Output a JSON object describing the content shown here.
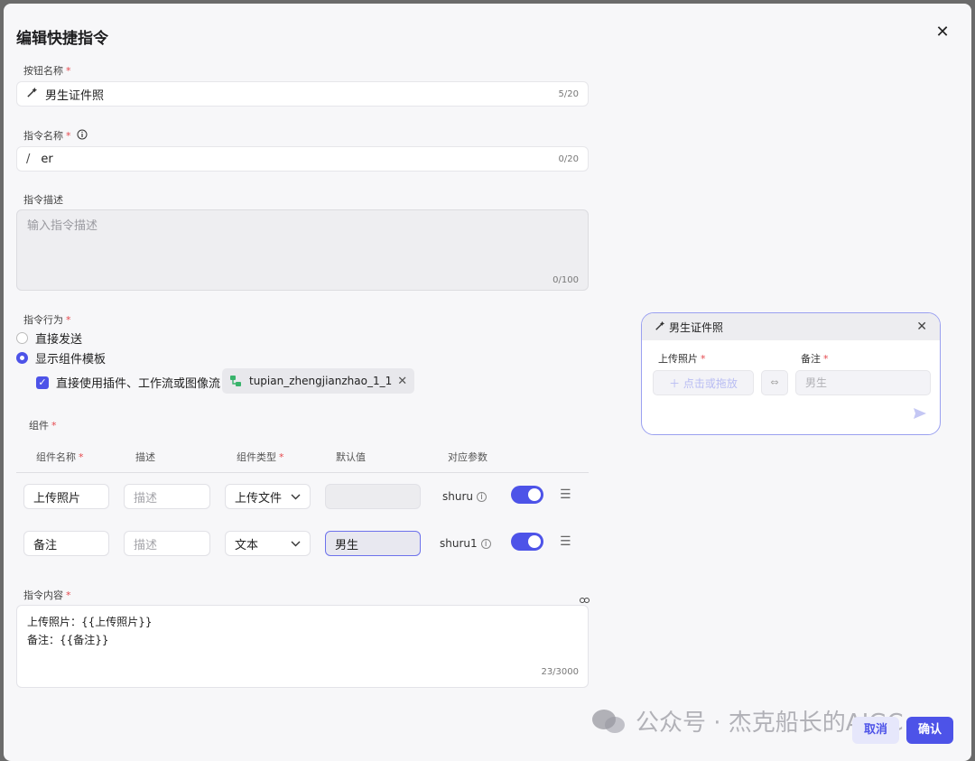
{
  "modal": {
    "title": "编辑快捷指令",
    "close_glyph": "✕"
  },
  "button_name": {
    "label": "按钮名称",
    "required_mark": "*",
    "value": "男生证件照",
    "counter": "5/20",
    "icon": "wand-icon"
  },
  "command_name": {
    "label": "指令名称",
    "required_mark": "*",
    "prefix": "/",
    "value": "er",
    "counter": "0/20"
  },
  "command_desc": {
    "label": "指令描述",
    "placeholder": "输入指令描述",
    "counter": "0/100"
  },
  "command_action": {
    "label": "指令行为",
    "required_mark": "*",
    "options": [
      {
        "label": "直接发送",
        "selected": false
      },
      {
        "label": "显示组件模板",
        "selected": true
      }
    ],
    "checkbox_label": "直接使用插件、工作流或图像流",
    "checkbox_checked": true,
    "workflow_chip": "tupian_zhengjianzhao_1_1",
    "chip_close": "✕"
  },
  "components": {
    "label": "组件",
    "required_mark": "*",
    "columns": {
      "name": "组件名称",
      "desc": "描述",
      "type": "组件类型",
      "default": "默认值",
      "param": "对应参数"
    },
    "rows": [
      {
        "name": "上传照片",
        "desc_placeholder": "描述",
        "type": "上传文件",
        "default": "",
        "param": "shuru",
        "enabled": true
      },
      {
        "name": "备注",
        "desc_placeholder": "描述",
        "type": "文本",
        "default": "男生",
        "param": "shuru1",
        "enabled": true
      }
    ]
  },
  "command_content": {
    "label": "指令内容",
    "required_mark": "*",
    "line1": "上传照片：{{上传照片}}",
    "line2": "备注：{{备注}}",
    "counter": "23/3000"
  },
  "preview": {
    "title": "男生证件照",
    "close_glyph": "✕",
    "field1_label": "上传照片",
    "field2_label": "备注",
    "upload_text": "＋ 点击或拖放",
    "note_placeholder": "男生",
    "send_icon": "send-icon"
  },
  "footer": {
    "cancel": "取消",
    "confirm": "确认"
  },
  "watermark": {
    "text": "公众号 · 杰克船长的AIGC"
  },
  "colors": {
    "accent": "#4d53e8",
    "required": "#e5484d"
  }
}
